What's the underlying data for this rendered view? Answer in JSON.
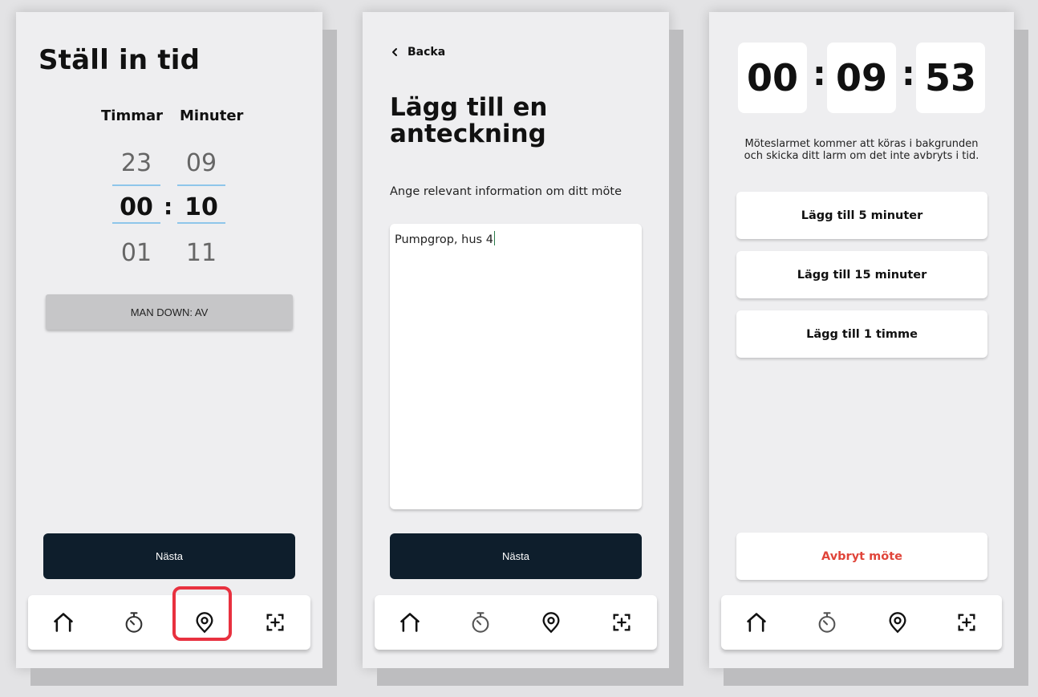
{
  "screen1": {
    "title": "Ställ in tid",
    "hours_label": "Timmar",
    "minutes_label": "Minuter",
    "hours_prev": "23",
    "hours_selected": "00",
    "hours_next": "01",
    "minutes_prev": "09",
    "minutes_selected": "10",
    "minutes_next": "11",
    "separator": ":",
    "man_down_label": "MAN DOWN: AV",
    "next_label": "Nästa"
  },
  "screen2": {
    "back_label": "Backa",
    "title": "Lägg till en anteckning",
    "instruction": "Ange relevant information om ditt möte",
    "note_text": "Pumpgrop, hus 4",
    "next_label": "Nästa"
  },
  "screen3": {
    "hours": "00",
    "minutes": "09",
    "seconds": "53",
    "separator": ":",
    "info_text": "Möteslarmet kommer att köras i bakgrunden och skicka ditt larm om det inte avbryts i tid.",
    "add5_label": "Lägg till 5 minuter",
    "add15_label": "Lägg till 15 minuter",
    "add60_label": "Lägg till 1 timme",
    "cancel_label": "Avbryt möte"
  },
  "nav": {
    "items": [
      "home-icon",
      "timer-icon",
      "location-icon",
      "scan-add-icon"
    ],
    "highlighted": "timer-icon"
  },
  "colors": {
    "primary_dark": "#0e1e2c",
    "cancel_red": "#e0453a",
    "highlight_red": "#e8313f",
    "picker_line": "#8ec6ea"
  }
}
